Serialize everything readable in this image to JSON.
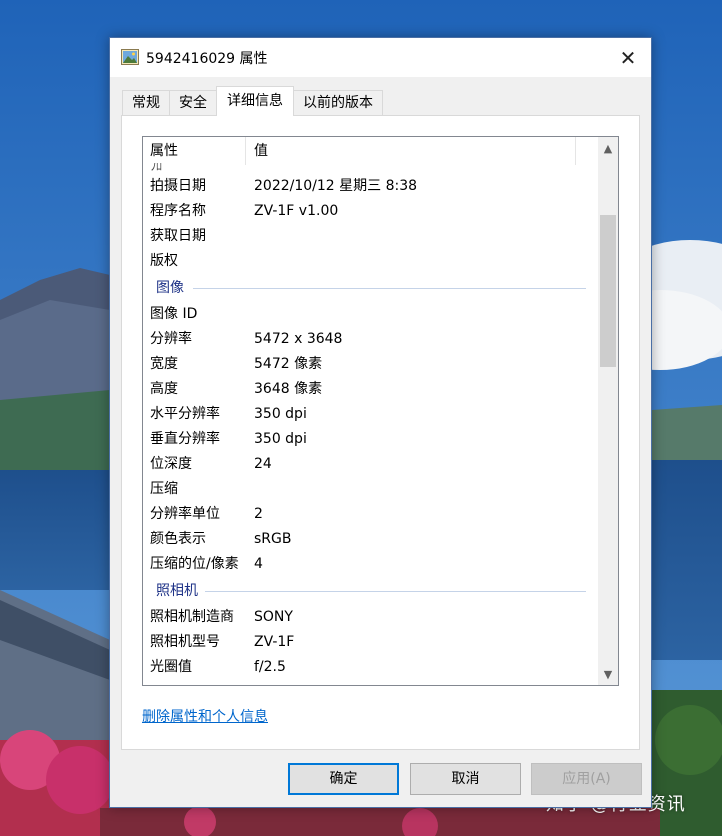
{
  "window": {
    "title": "5942416029 属性",
    "close_glyph": "✕"
  },
  "tabs": [
    {
      "label": "常规"
    },
    {
      "label": "安全"
    },
    {
      "label": "详细信息",
      "active": true
    },
    {
      "label": "以前的版本"
    }
  ],
  "list": {
    "header": {
      "name": "属性",
      "value": "值"
    },
    "partial_row": "ﾌﾛ",
    "rows_top": [
      {
        "key": "拍摄日期",
        "value": "2022/10/12 星期三 8:38"
      },
      {
        "key": "程序名称",
        "value": "ZV-1F v1.00"
      },
      {
        "key": "获取日期",
        "value": ""
      },
      {
        "key": "版权",
        "value": ""
      }
    ],
    "group_image": "图像",
    "rows_image": [
      {
        "key": "图像 ID",
        "value": ""
      },
      {
        "key": "分辨率",
        "value": "5472 x 3648"
      },
      {
        "key": "宽度",
        "value": "5472 像素"
      },
      {
        "key": "高度",
        "value": "3648 像素"
      },
      {
        "key": "水平分辨率",
        "value": "350 dpi"
      },
      {
        "key": "垂直分辨率",
        "value": "350 dpi"
      },
      {
        "key": "位深度",
        "value": "24"
      },
      {
        "key": "压缩",
        "value": ""
      },
      {
        "key": "分辨率单位",
        "value": "2"
      },
      {
        "key": "颜色表示",
        "value": "sRGB"
      },
      {
        "key": "压缩的位/像素",
        "value": "4"
      }
    ],
    "group_camera": "照相机",
    "rows_camera": [
      {
        "key": "照相机制造商",
        "value": "SONY"
      },
      {
        "key": "照相机型号",
        "value": "ZV-1F"
      },
      {
        "key": "光圈值",
        "value": "f/2.5"
      }
    ],
    "scroll_up_glyph": "▲",
    "scroll_down_glyph": "▼"
  },
  "remove_link": "删除属性和个人信息",
  "buttons": {
    "ok": "确定",
    "cancel": "取消",
    "apply": "应用(A)"
  },
  "watermark": "知乎 @行业资讯",
  "colors": {
    "link": "#0066cc",
    "group_header": "#1e3287",
    "ok_border": "#0078d7"
  }
}
